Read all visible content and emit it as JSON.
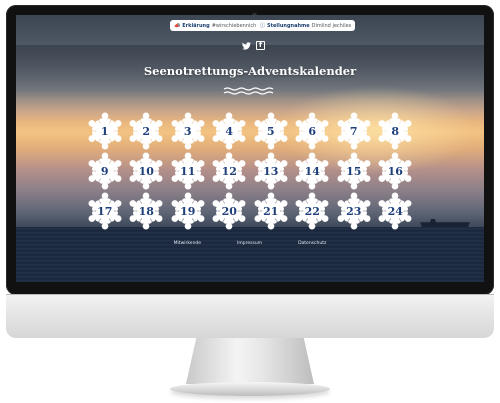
{
  "header": {
    "explain_button": {
      "label": "Erklärung",
      "sub": "#wirschiebennicht",
      "icon": "megaphone-icon"
    },
    "statement_button": {
      "label": "Stellungnahme",
      "sub": "Dimlind jechiles",
      "icon": "info-icon"
    },
    "social": [
      {
        "name": "twitter-icon",
        "glyph": "🐦"
      },
      {
        "name": "facebook-icon",
        "glyph": "f"
      }
    ]
  },
  "page": {
    "title": "Seenotrettungs-Adventskalender"
  },
  "calendar": {
    "doors": [
      "1",
      "2",
      "3",
      "4",
      "5",
      "6",
      "7",
      "8",
      "9",
      "10",
      "11",
      "12",
      "13",
      "14",
      "15",
      "16",
      "17",
      "18",
      "19",
      "20",
      "21",
      "22",
      "23",
      "24"
    ]
  },
  "footer": {
    "links": [
      {
        "label": "Mitwirkende"
      },
      {
        "label": "Impressum"
      },
      {
        "label": "Datenschutz"
      }
    ]
  },
  "colors": {
    "door_number": "#1e3f7a",
    "flake": "#ffffff",
    "sea": "#1b2738"
  }
}
